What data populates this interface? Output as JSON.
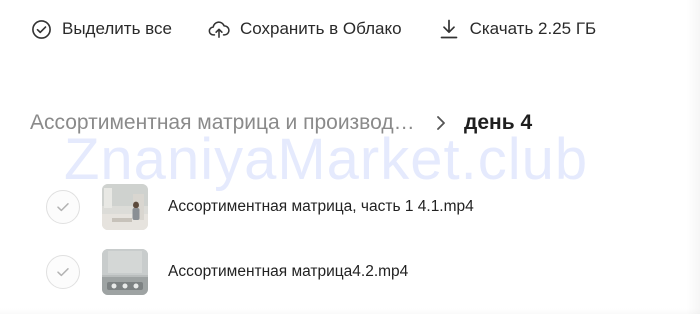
{
  "toolbar": {
    "select_all": {
      "label": "Выделить все",
      "icon": "check-circle-icon"
    },
    "save_cloud": {
      "label": "Сохранить в Облако",
      "icon": "cloud-upload-icon"
    },
    "download": {
      "label": "Скачать 2.25 ГБ",
      "icon": "download-icon"
    }
  },
  "breadcrumb": {
    "parent": "Ассортиментная матрица и производство",
    "separator_icon": "chevron-right-icon",
    "current": "день 4"
  },
  "watermark": "ZnaniyaMarket.club",
  "files": [
    {
      "name": "Ассортиментная матрица, часть 1 4.1.mp4",
      "thumbnail": "video-thumbnail"
    },
    {
      "name": "Ассортиментная матрица4.2.mp4",
      "thumbnail": "video-thumbnail"
    }
  ],
  "colors": {
    "text_primary": "#1f1f1f",
    "text_muted": "#8a8a8a",
    "icon": "#333333",
    "watermark": "#6482f5"
  }
}
